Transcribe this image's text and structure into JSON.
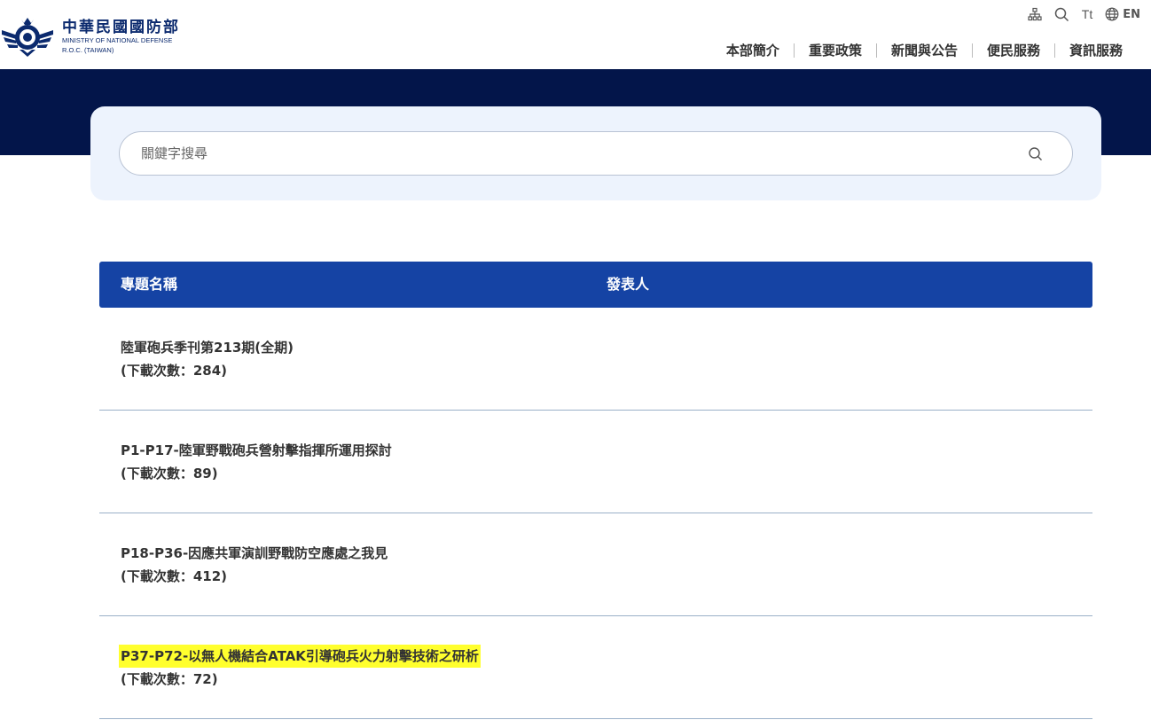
{
  "header": {
    "brand_zh": "中華民國國防部",
    "brand_en_line1": "MINISTRY OF NATIONAL DEFENSE",
    "brand_en_line2": "R.O.C. (TAIWAN)",
    "utils": {
      "sitemap_icon": "sitemap-icon",
      "search_icon": "search-icon",
      "font_size_label": "Tt",
      "language_icon": "globe-icon",
      "language_label": "EN"
    },
    "nav": [
      "本部簡介",
      "重要政策",
      "新聞與公告",
      "便民服務",
      "資訊服務"
    ]
  },
  "search": {
    "placeholder": "關鍵字搜尋",
    "value": ""
  },
  "table": {
    "columns": [
      "專題名稱",
      "發表人"
    ],
    "rows": [
      {
        "title": "陸軍砲兵季刊第213期(全期)",
        "count": "(下載次數：284)",
        "author": ""
      },
      {
        "title": "P1-P17-陸軍野戰砲兵營射擊指揮所運用探討",
        "count": "(下載次數：89)",
        "author": ""
      },
      {
        "title": "P18-P36-因應共軍演訓野戰防空應處之我見",
        "count": "(下載次數：412)",
        "author": ""
      },
      {
        "title": "P37-P72-以無人機結合ATAK引導砲兵火力射擊技術之研析",
        "count": "(下載次數：72)",
        "author": "",
        "highlighted": true
      }
    ]
  },
  "colors": {
    "navy_banner": "#03154a",
    "table_header": "#1543a4",
    "search_card": "#edf3fd",
    "highlight": "#ffff2e",
    "brand": "#0b2a6e"
  }
}
